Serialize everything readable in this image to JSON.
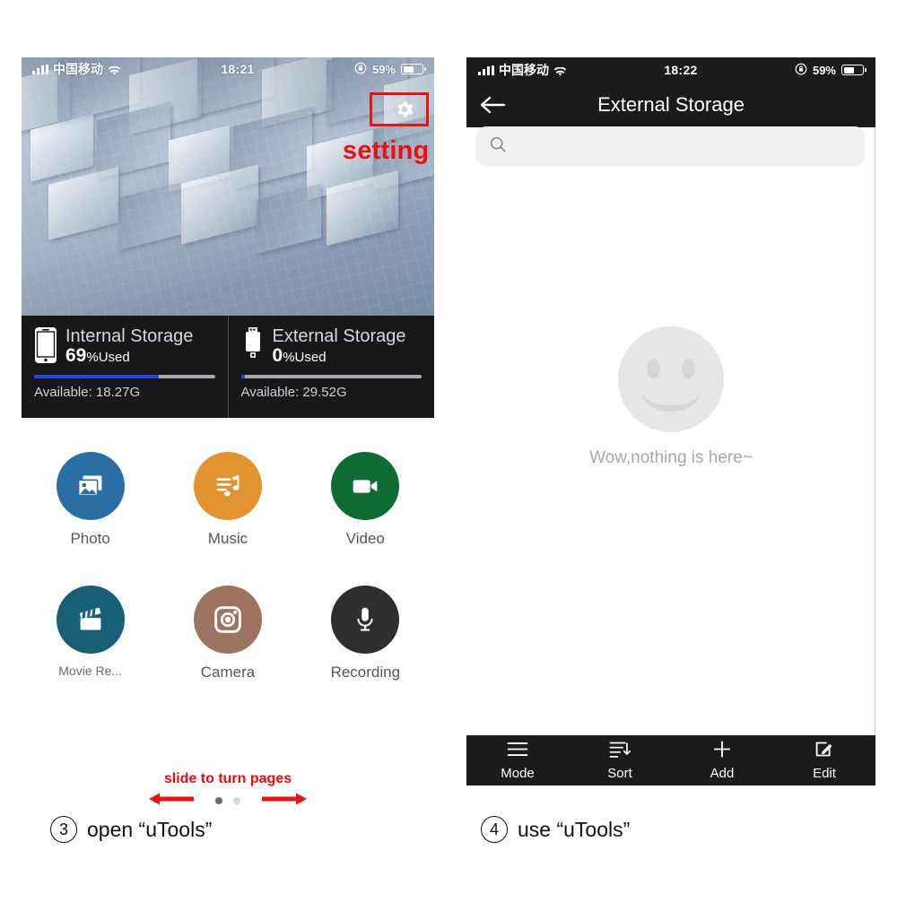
{
  "left_phone": {
    "status_bar": {
      "carrier": "中国移动",
      "time": "18:21",
      "battery_percent": "59%",
      "battery_level": 59,
      "signal_icon": "signal-bars-icon",
      "wifi_icon": "wifi-icon",
      "rotation_lock_icon": "rotation-lock-icon"
    },
    "annotations": {
      "setting_label": "setting",
      "slide_hint": "slide to turn pages"
    },
    "gear_button": {
      "icon": "gear-icon",
      "highlight_color": "#ee1111"
    },
    "storage": [
      {
        "icon": "phone-icon",
        "title": "Internal Storage",
        "used_value": "69",
        "used_suffix": "%Used",
        "used_percent": 69,
        "available": "Available: 18.27G",
        "bar_color": "#1f49e0"
      },
      {
        "icon": "usb-drive-icon",
        "title": "External Storage",
        "used_value": "0",
        "used_suffix": "%Used",
        "used_percent": 2,
        "available": "Available: 29.52G",
        "bar_color": "#1f49e0"
      }
    ],
    "apps": [
      [
        {
          "label": "Photo",
          "icon": "photo-icon",
          "color": "#2a6ea6"
        },
        {
          "label": "Music",
          "icon": "music-note-icon",
          "color": "#e2922f"
        },
        {
          "label": "Video",
          "icon": "video-camera-icon",
          "color": "#0e6b32"
        }
      ],
      [
        {
          "label": "Movie Re...",
          "icon": "clapperboard-icon",
          "color": "#175f75"
        },
        {
          "label": "Camera",
          "icon": "camera-icon",
          "color": "#9c7461"
        },
        {
          "label": "Recording",
          "icon": "microphone-icon",
          "color": "#2e2e2e"
        }
      ]
    ],
    "page_dots": {
      "count": 2,
      "active_index": 0
    }
  },
  "right_phone": {
    "status_bar": {
      "carrier": "中国移动",
      "time": "18:22",
      "battery_percent": "59%",
      "battery_level": 59,
      "signal_icon": "signal-bars-icon",
      "wifi_icon": "wifi-icon",
      "rotation_lock_icon": "rotation-lock-icon"
    },
    "nav": {
      "back_icon": "back-arrow-icon",
      "title": "External Storage"
    },
    "search": {
      "icon": "search-icon",
      "value": "",
      "placeholder": ""
    },
    "empty_state": {
      "icon": "smiley-face-icon",
      "message": "Wow,nothing is here~"
    },
    "toolbar": [
      {
        "label": "Mode",
        "icon": "list-lines-icon"
      },
      {
        "label": "Sort",
        "icon": "sort-arrow-icon"
      },
      {
        "label": "Add",
        "icon": "plus-icon"
      },
      {
        "label": "Edit",
        "icon": "pencil-square-icon"
      }
    ]
  },
  "captions": {
    "left": {
      "number": "3",
      "text": "open “uTools”"
    },
    "right": {
      "number": "4",
      "text": "use “uTools”"
    }
  }
}
